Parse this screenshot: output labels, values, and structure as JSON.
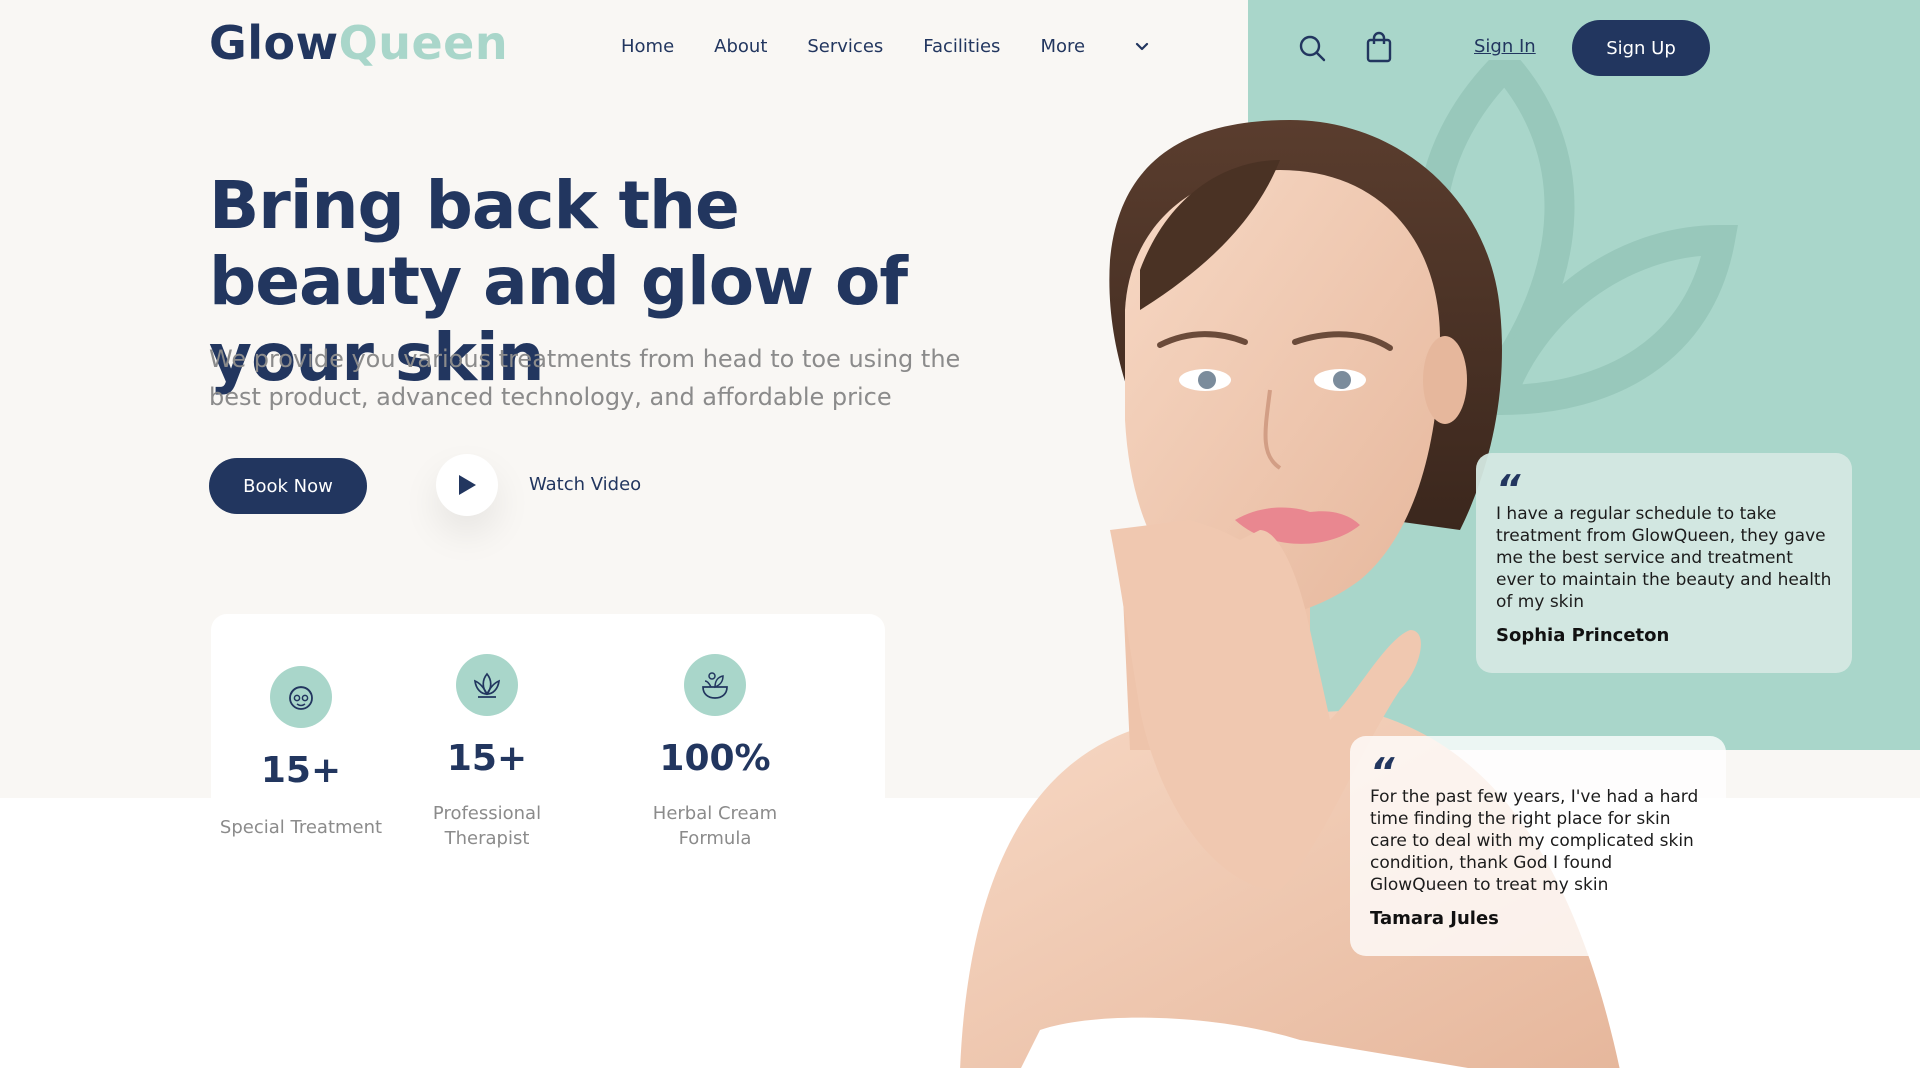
{
  "brand": {
    "part1": "Glow",
    "part2": "Queen"
  },
  "nav": {
    "items": [
      "Home",
      "About",
      "Services",
      "Facilities",
      "More"
    ]
  },
  "header": {
    "search_icon": "search-icon",
    "cart_icon": "shopping-bag-icon",
    "signin_label": "Sign In",
    "signup_label": "Sign Up"
  },
  "hero": {
    "headline": "Bring back the beauty and glow of your skin",
    "subtext": "We provide you various treatments from head to toe using the best product, advanced technology, and affordable price",
    "book_label": "Book Now",
    "watch_label": "Watch Video"
  },
  "stats": [
    {
      "icon": "face-mask-icon",
      "value": "15+",
      "label": "Special Treatment"
    },
    {
      "icon": "lotus-icon",
      "value": "15+",
      "label": "Professional Therapist"
    },
    {
      "icon": "herbal-bowl-icon",
      "value": "100%",
      "label": "Herbal Cream Formula"
    }
  ],
  "testimonials": [
    {
      "text": "I have a regular schedule to take treatment from GlowQueen, they gave me the best service and treatment ever to maintain the beauty and health of my skin",
      "name": "Sophia Princeton"
    },
    {
      "text": "For the past few years, I've had a hard time finding the right place for skin care to deal with my complicated skin condition, thank God I found GlowQueen to treat my skin",
      "name": "Tamara Jules"
    }
  ],
  "colors": {
    "navy": "#22365f",
    "mint": "#a9d6ca",
    "cream": "#f9f7f4",
    "grey_text": "#8b8b8b"
  }
}
